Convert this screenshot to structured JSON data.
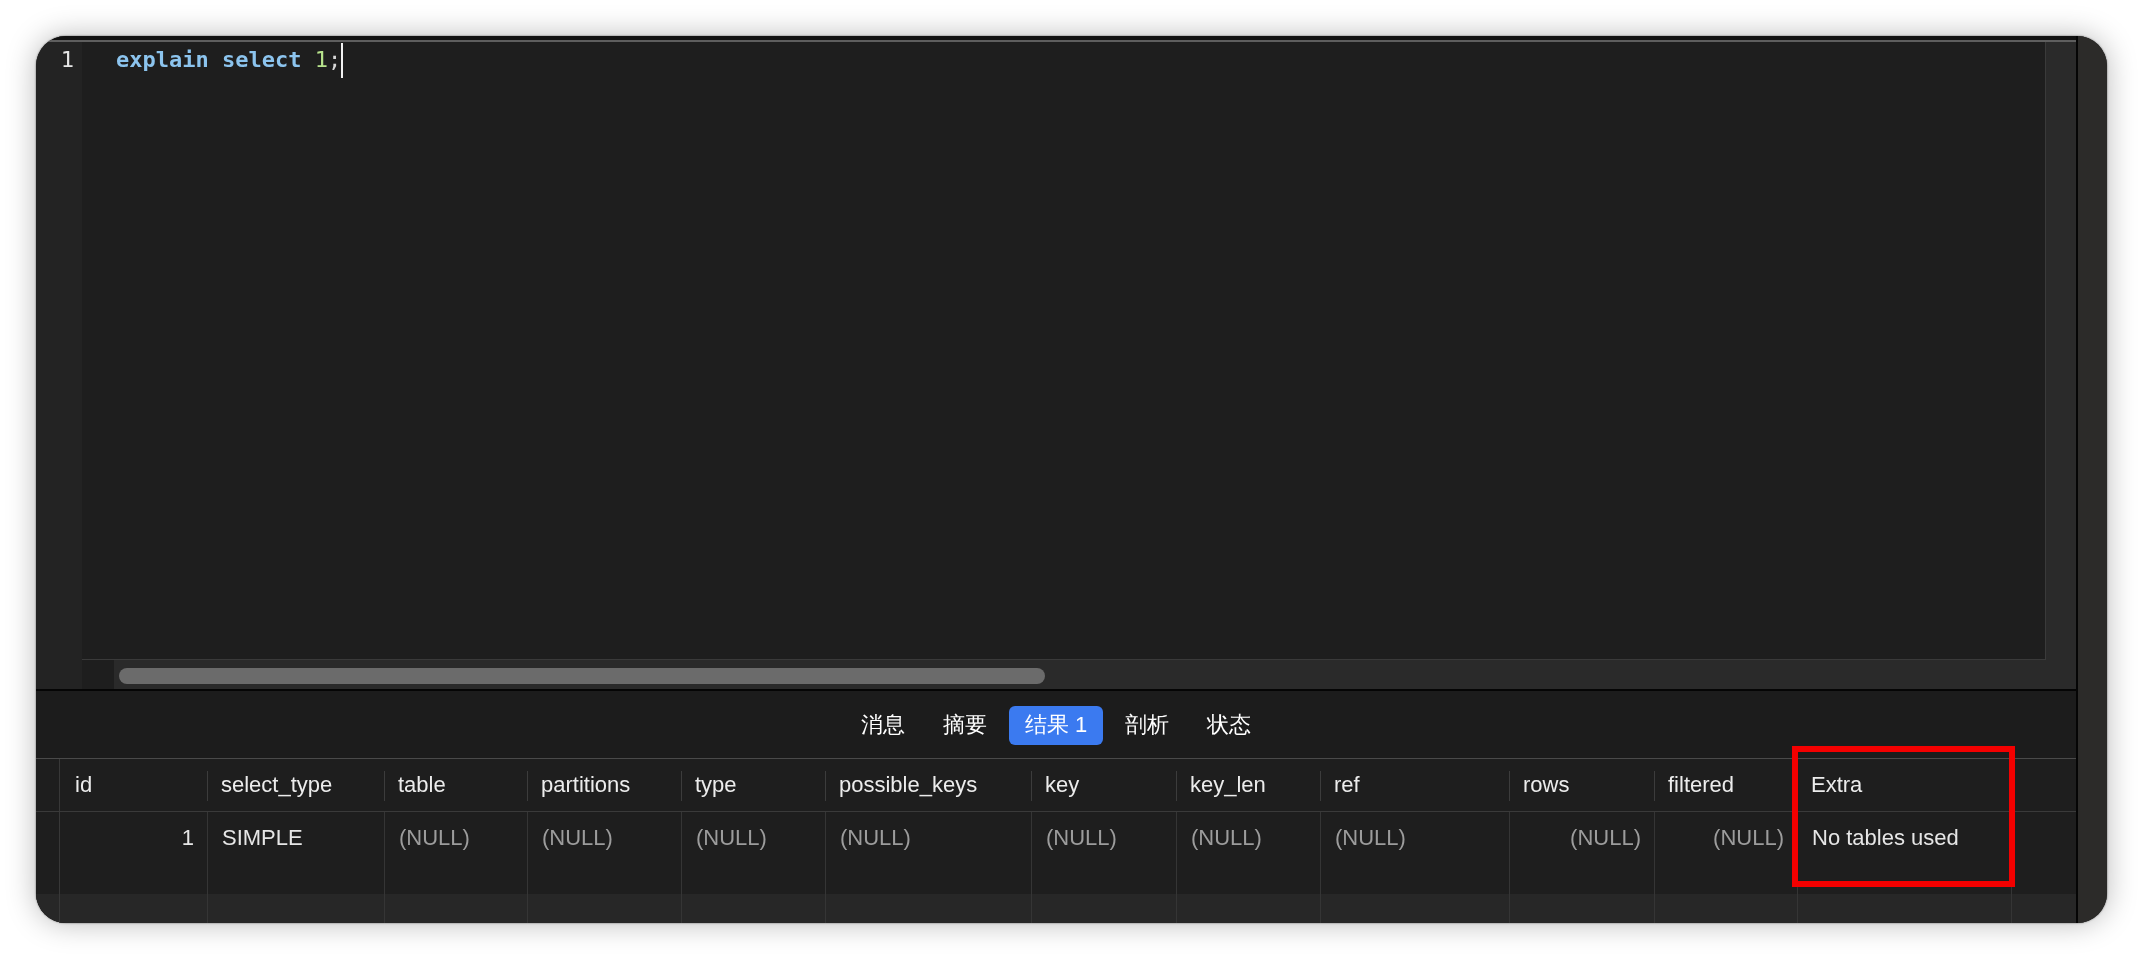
{
  "editor": {
    "lines": [
      {
        "number": "1",
        "tokens": [
          {
            "kind": "keyword",
            "text": "explain select "
          },
          {
            "kind": "number",
            "text": "1"
          },
          {
            "kind": "punctuation",
            "text": ";"
          }
        ],
        "cursor": true
      }
    ]
  },
  "tabs": [
    {
      "label": "消息",
      "selected": false
    },
    {
      "label": "摘要",
      "selected": false
    },
    {
      "label": "结果 1",
      "selected": true
    },
    {
      "label": "剖析",
      "selected": false
    },
    {
      "label": "状态",
      "selected": false
    }
  ],
  "table": {
    "columns": [
      {
        "label": "id",
        "right_aligned": true,
        "highlighted": false
      },
      {
        "label": "select_type",
        "right_aligned": false,
        "highlighted": false
      },
      {
        "label": "table",
        "right_aligned": false,
        "highlighted": false
      },
      {
        "label": "partitions",
        "right_aligned": false,
        "highlighted": false
      },
      {
        "label": "type",
        "right_aligned": false,
        "highlighted": false
      },
      {
        "label": "possible_keys",
        "right_aligned": false,
        "highlighted": false
      },
      {
        "label": "key",
        "right_aligned": false,
        "highlighted": false
      },
      {
        "label": "key_len",
        "right_aligned": false,
        "highlighted": false
      },
      {
        "label": "ref",
        "right_aligned": false,
        "highlighted": false
      },
      {
        "label": "rows",
        "right_aligned": true,
        "highlighted": false
      },
      {
        "label": "filtered",
        "right_aligned": true,
        "highlighted": false
      },
      {
        "label": "Extra",
        "right_aligned": false,
        "highlighted": true
      }
    ],
    "rows": [
      {
        "cells": [
          {
            "text": "1",
            "null": false
          },
          {
            "text": "SIMPLE",
            "null": false
          },
          {
            "text": "(NULL)",
            "null": true
          },
          {
            "text": "(NULL)",
            "null": true
          },
          {
            "text": "(NULL)",
            "null": true
          },
          {
            "text": "(NULL)",
            "null": true
          },
          {
            "text": "(NULL)",
            "null": true
          },
          {
            "text": "(NULL)",
            "null": true
          },
          {
            "text": "(NULL)",
            "null": true
          },
          {
            "text": "(NULL)",
            "null": true
          },
          {
            "text": "(NULL)",
            "null": true
          },
          {
            "text": "No tables used",
            "null": false
          }
        ]
      }
    ]
  }
}
